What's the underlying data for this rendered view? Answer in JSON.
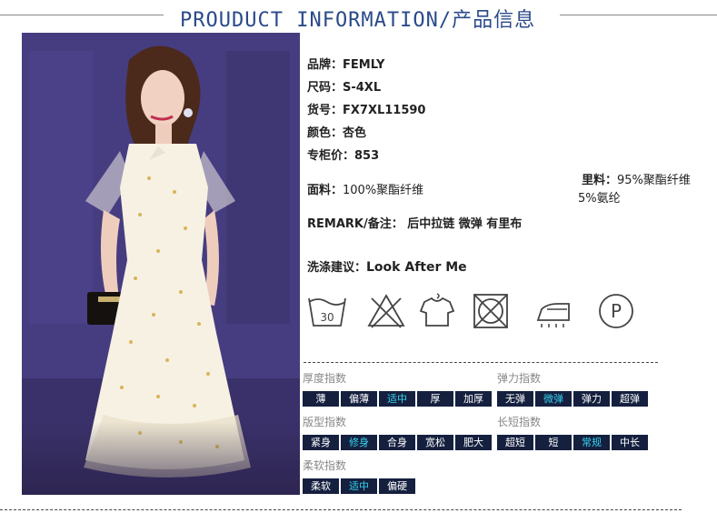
{
  "header": {
    "title": "PROUDUCT INFORMATION/产品信息"
  },
  "info": {
    "brand": "品牌：FEMLY",
    "size": "尺码：S-4XL",
    "sku": "货号：FX7XL11590",
    "color": "颜色：杏色",
    "price": "专柜价：853",
    "fabric_label": "面料：",
    "fabric_value": "100%聚酯纤维",
    "lining_label": "里料：",
    "lining_value1": "95%聚酯纤维",
    "lining_value2": "5%氨纶",
    "remark": "REMARK/备注： 后中拉链 微弹 有里布",
    "wash_label": "洗涤建议：",
    "wash_value": "Look After Me"
  },
  "care_icons": [
    "wash-30-icon",
    "no-bleach-icon",
    "hang-dry-icon",
    "no-tumble-dry-icon",
    "iron-icon",
    "dry-clean-p-icon"
  ],
  "care_text": {
    "wash_temp": "30",
    "dry_clean": "P"
  },
  "indices": {
    "thickness": {
      "title": "厚度指数",
      "options": [
        "薄",
        "偏薄",
        "适中",
        "厚",
        "加厚"
      ],
      "selected": "适中"
    },
    "elasticity": {
      "title": "弹力指数",
      "options": [
        "无弹",
        "微弹",
        "弹力",
        "超弹"
      ],
      "selected": "微弹"
    },
    "fit": {
      "title": "版型指数",
      "options": [
        "紧身",
        "修身",
        "合身",
        "宽松",
        "肥大"
      ],
      "selected": "修身"
    },
    "length": {
      "title": "长短指数",
      "options": [
        "超短",
        "短",
        "常规",
        "中长"
      ],
      "selected": "常规"
    },
    "softness": {
      "title": "柔软指数",
      "options": [
        "柔软",
        "适中",
        "偏硬"
      ],
      "selected": "适中"
    }
  },
  "colors": {
    "box_bg": "#15203f",
    "box_selected_text": "#35d3ee",
    "title_blue": "#2a4a8a",
    "photo_bg": "#4a3f85"
  }
}
